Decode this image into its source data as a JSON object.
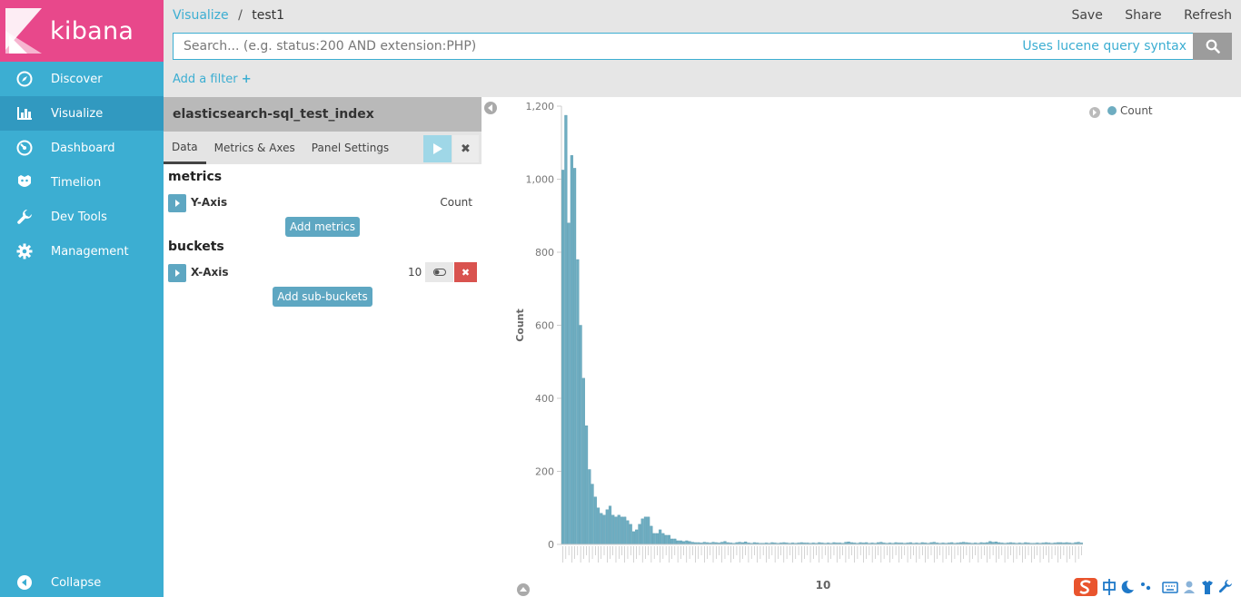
{
  "app": {
    "name": "kibana"
  },
  "sidebar": {
    "items": [
      {
        "label": "Discover",
        "icon": "compass-icon"
      },
      {
        "label": "Visualize",
        "icon": "bar-chart-icon"
      },
      {
        "label": "Dashboard",
        "icon": "gauge-icon"
      },
      {
        "label": "Timelion",
        "icon": "timelion-icon"
      },
      {
        "label": "Dev Tools",
        "icon": "wrench-icon"
      },
      {
        "label": "Management",
        "icon": "gear-icon"
      }
    ],
    "active": "Visualize",
    "collapse_label": "Collapse"
  },
  "header": {
    "breadcrumb_link": "Visualize",
    "breadcrumb_sep": "/",
    "breadcrumb_current": "test1",
    "save_label": "Save",
    "share_label": "Share",
    "refresh_label": "Refresh"
  },
  "search": {
    "placeholder": "Search... (e.g. status:200 AND extension:PHP)",
    "value": "",
    "syntax_link": "Uses lucene query syntax"
  },
  "filter": {
    "add_label": "Add a filter"
  },
  "editor": {
    "index_name": "elasticsearch-sql_test_index",
    "tabs": [
      "Data",
      "Metrics & Axes",
      "Panel Settings"
    ],
    "active_tab": "Data",
    "metrics_title": "metrics",
    "y_axis_label": "Y-Axis",
    "y_axis_value": "Count",
    "add_metrics_label": "Add metrics",
    "buckets_title": "buckets",
    "x_axis_label": "X-Axis",
    "x_axis_value": "10",
    "add_sub_buckets_label": "Add sub-buckets"
  },
  "colors": {
    "sidebar": "#3caed2",
    "logo": "#e8488b",
    "bar": "#6eadc1",
    "danger": "#d9534f"
  },
  "chart_data": {
    "type": "bar",
    "ylabel": "Count",
    "xlabel": "10",
    "ylim": [
      0,
      1200
    ],
    "yticks": [
      0,
      200,
      400,
      600,
      800,
      1000,
      1200
    ],
    "y_tick_labels": [
      "0",
      "200",
      "400",
      "600",
      "800",
      "1,000",
      "1,200"
    ],
    "legend": [
      {
        "name": "Count",
        "color": "#6eadc1"
      }
    ],
    "legend_position": "top-right",
    "grid": false,
    "series": [
      {
        "name": "Count",
        "values": [
          1025,
          1175,
          880,
          1065,
          1030,
          780,
          600,
          455,
          325,
          205,
          165,
          130,
          100,
          85,
          80,
          95,
          105,
          80,
          75,
          80,
          75,
          75,
          65,
          55,
          35,
          40,
          55,
          70,
          75,
          75,
          50,
          30,
          30,
          40,
          30,
          25,
          25,
          15,
          15,
          10,
          10,
          8,
          10,
          8,
          6,
          5,
          5,
          4,
          6,
          5,
          4,
          6,
          5,
          4,
          6,
          8,
          5,
          4,
          3,
          5,
          6,
          5,
          7,
          4,
          3,
          5,
          4,
          3,
          3,
          4,
          3,
          5,
          4,
          3,
          4,
          5,
          4,
          3,
          4,
          3,
          4,
          5,
          4,
          4,
          3,
          4,
          3,
          5,
          4,
          3,
          4,
          3,
          5,
          4,
          4,
          3,
          6,
          7,
          5,
          4,
          3,
          5,
          4,
          5,
          3,
          4,
          3,
          5,
          6,
          4,
          3,
          4,
          3,
          5,
          4,
          4,
          3,
          4,
          5,
          3,
          4,
          3,
          5,
          4,
          3,
          5,
          6,
          4,
          3,
          4,
          3,
          4,
          5,
          3,
          4,
          5,
          6,
          5,
          4,
          3,
          4,
          3,
          5,
          4,
          5,
          8,
          6,
          7,
          5,
          4,
          3,
          4,
          5,
          4,
          3,
          4,
          3,
          5,
          4,
          3,
          3,
          4,
          3,
          4,
          5,
          4,
          3,
          4,
          5,
          5,
          4,
          5,
          4,
          3,
          5,
          6,
          4
        ]
      }
    ]
  }
}
